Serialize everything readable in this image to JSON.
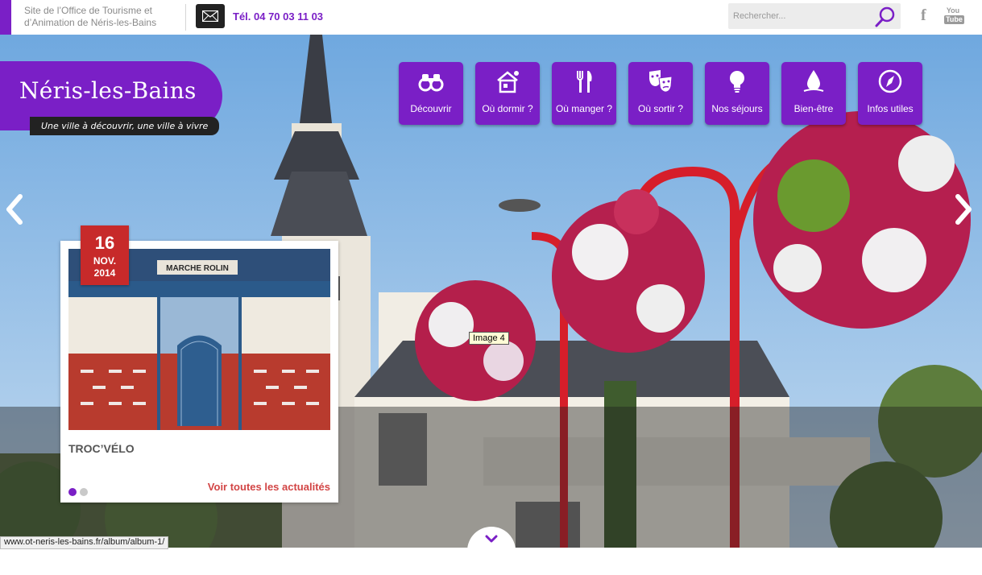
{
  "header": {
    "description_line1": "Site de l’Office de Tourisme et",
    "description_line2": "d’Animation de Néris-les-Bains",
    "phone": "Tél. 04 70 03 11 03",
    "search_placeholder": "Rechercher...",
    "social": {
      "facebook": "f",
      "youtube_top": "You",
      "youtube_bottom": "Tube"
    }
  },
  "logo": {
    "name": "Néris-les-Bains",
    "tagline": "Une ville à découvrir, une ville à vivre"
  },
  "nav": [
    {
      "label": "Découvrir",
      "icon": "binoculars-icon"
    },
    {
      "label": "Où dormir ?",
      "icon": "house-icon"
    },
    {
      "label": "Où manger ?",
      "icon": "fork-knife-icon"
    },
    {
      "label": "Où sortir ?",
      "icon": "theater-masks-icon"
    },
    {
      "label": "Nos séjours",
      "icon": "lightbulb-icon"
    },
    {
      "label": "Bien-être",
      "icon": "water-drop-icon"
    },
    {
      "label": "Infos utiles",
      "icon": "compass-icon"
    }
  ],
  "slider": {
    "tooltip": "Image 4"
  },
  "news": {
    "day": "16",
    "month": "NOV.",
    "year": "2014",
    "sign_text": "MARCHE ROLIN",
    "title": "TROC’VÉLO",
    "more_link": "Voir toutes les actualités"
  },
  "statusbar": {
    "url": "www.ot-neris-les-bains.fr/album/album-1/"
  },
  "colors": {
    "brand_purple": "#7a1fc6",
    "date_red": "#c72a2a",
    "link_red": "#d24545"
  }
}
